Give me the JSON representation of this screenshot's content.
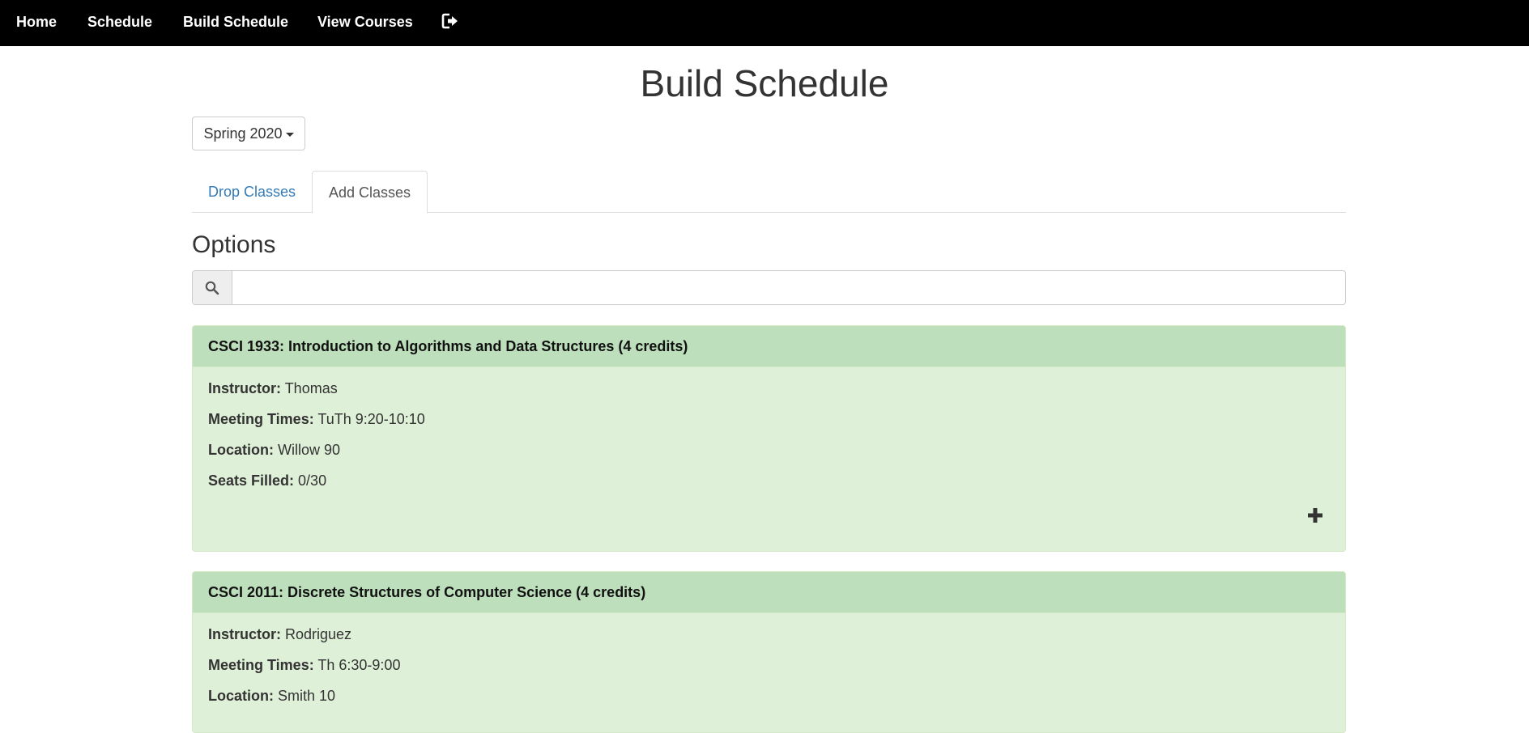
{
  "nav": {
    "home": "Home",
    "schedule": "Schedule",
    "build_schedule": "Build Schedule",
    "view_courses": "View Courses",
    "logout_icon": "sign-out-icon"
  },
  "page_title": "Build Schedule",
  "term_dropdown": {
    "selected": "Spring 2020"
  },
  "tabs": [
    {
      "label": "Drop Classes",
      "active": false
    },
    {
      "label": "Add Classes",
      "active": true
    }
  ],
  "options_heading": "Options",
  "search": {
    "icon": "search-icon",
    "value": "",
    "placeholder": ""
  },
  "field_labels": {
    "instructor": "Instructor:",
    "meeting_times": "Meeting Times:",
    "location": "Location:",
    "seats_filled": "Seats Filled:"
  },
  "courses": [
    {
      "title": "CSCI 1933: Introduction to Algorithms and Data Structures (4 credits)",
      "instructor": "Thomas",
      "meeting_times": "TuTh 9:20-10:10",
      "location": "Willow 90",
      "seats_filled": "0/30",
      "action_icon": "plus-icon"
    },
    {
      "title": "CSCI 2011: Discrete Structures of Computer Science (4 credits)",
      "instructor": "Rodriguez",
      "meeting_times": "Th 6:30-9:00",
      "location": "Smith 10"
    }
  ],
  "colors": {
    "navbar": "#000000",
    "panel_heading": "#bddfbc",
    "panel_body": "#dff0d8",
    "link": "#337ab7"
  }
}
